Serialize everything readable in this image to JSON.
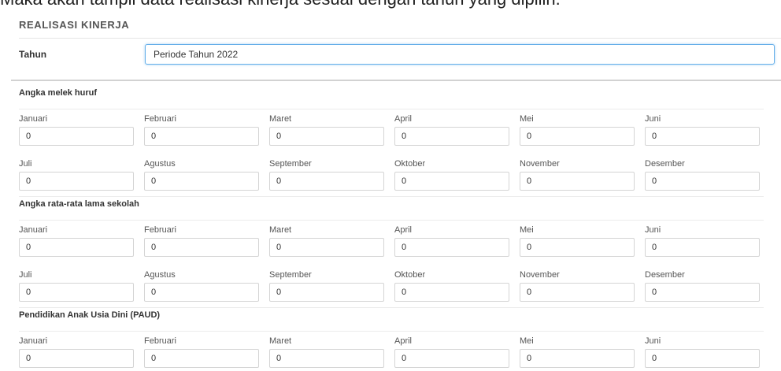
{
  "caption": "Maka akan tampil data realisasi kinerja sesuai dengan tahun yang dipilih.",
  "panel": {
    "title": "REALISASI KINERJA",
    "year_label": "Tahun",
    "year_value": "Periode Tahun 2022"
  },
  "months": [
    "Januari",
    "Februari",
    "Maret",
    "April",
    "Mei",
    "Juni",
    "Juli",
    "Agustus",
    "September",
    "Oktober",
    "November",
    "Desember"
  ],
  "sections": [
    {
      "title": "Angka melek huruf",
      "values": [
        "0",
        "0",
        "0",
        "0",
        "0",
        "0",
        "0",
        "0",
        "0",
        "0",
        "0",
        "0"
      ]
    },
    {
      "title": "Angka rata-rata lama sekolah",
      "values": [
        "0",
        "0",
        "0",
        "0",
        "0",
        "0",
        "0",
        "0",
        "0",
        "0",
        "0",
        "0"
      ]
    },
    {
      "title": "Pendidikan Anak Usia Dini (PAUD)",
      "values": [
        "0",
        "0",
        "0",
        "0",
        "0",
        "0"
      ]
    }
  ]
}
